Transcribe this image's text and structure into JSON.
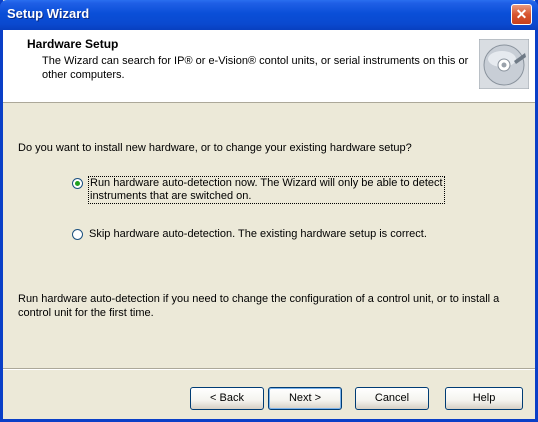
{
  "window": {
    "title": "Setup Wizard"
  },
  "header": {
    "title": "Hardware Setup",
    "subtitle": "The Wizard can search for IP® or e-Vision® contol units, or serial instruments on this or other computers."
  },
  "content": {
    "question": "Do you want to install new hardware, or to change your existing hardware setup?",
    "options": [
      {
        "label_line1": "Run hardware auto-detection now.  The Wizard will only be able to detect",
        "label_line2": "instruments that are switched on.",
        "checked": true
      },
      {
        "label": "Skip hardware auto-detection.  The existing hardware setup is correct.",
        "checked": false
      }
    ],
    "note": "Run hardware auto-detection if you need to change the configuration of a control unit, or to install a control unit for the first time."
  },
  "buttons": {
    "back": "< Back",
    "next": "Next >",
    "cancel": "Cancel",
    "help": "Help"
  },
  "icons": {
    "close": "close-icon",
    "header": "cd-disc-icon"
  }
}
